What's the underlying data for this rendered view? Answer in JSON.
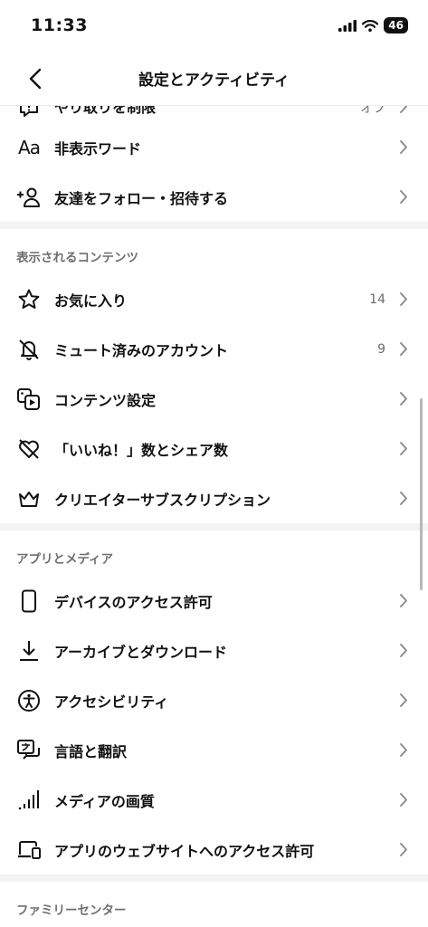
{
  "status": {
    "time": "11:33",
    "battery": "46"
  },
  "header": {
    "title": "設定とアクティビティ"
  },
  "rows_top": {
    "restrict": {
      "label": "やり取りを制限",
      "value": "オフ"
    },
    "hidden_words": {
      "label": "非表示ワード",
      "icon_text": "Aa"
    },
    "follow_invite": {
      "label": "友達をフォロー・招待する"
    }
  },
  "section_content": {
    "title": "表示されるコンテンツ",
    "favorites": {
      "label": "お気に入り",
      "count": "14"
    },
    "muted": {
      "label": "ミュート済みのアカウント",
      "count": "9"
    },
    "content_settings": {
      "label": "コンテンツ設定"
    },
    "likes_shares": {
      "label": "「いいね！」数とシェア数"
    },
    "creator_subs": {
      "label": "クリエイターサブスクリプション"
    }
  },
  "section_apps": {
    "title": "アプリとメディア",
    "device_permissions": {
      "label": "デバイスのアクセス許可"
    },
    "archive_download": {
      "label": "アーカイブとダウンロード"
    },
    "accessibility": {
      "label": "アクセシビリティ"
    },
    "language": {
      "label": "言語と翻訳"
    },
    "media_quality": {
      "label": "メディアの画質"
    },
    "website_permissions": {
      "label": "アプリのウェブサイトへのアクセス許可"
    }
  },
  "section_family": {
    "title": "ファミリーセンター"
  },
  "icons": {
    "restrict": "restrict-icon",
    "hidden_words": "text-aa-icon",
    "follow": "add-person-icon",
    "favorites": "star-icon",
    "muted": "bell-off-icon",
    "content": "media-settings-icon",
    "likes": "heart-off-icon",
    "creator": "crown-icon",
    "device": "phone-icon",
    "archive": "download-icon",
    "accessibility": "accessibility-icon",
    "language": "translate-icon",
    "media_quality": "signal-bars-icon",
    "website": "devices-icon",
    "chevron": "chevron-right-icon"
  }
}
